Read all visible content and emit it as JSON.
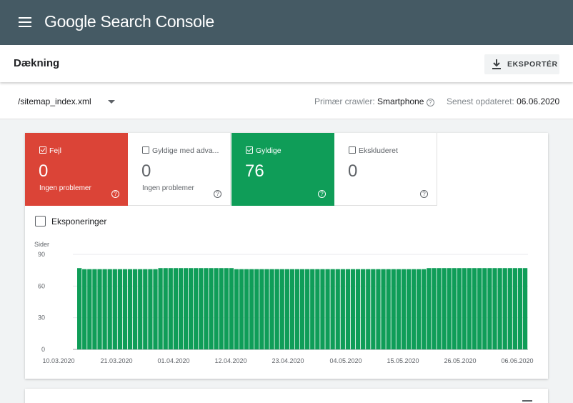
{
  "app": {
    "brand": "Google Search Console"
  },
  "page": {
    "title": "Dækning",
    "export_label": "EKSPORTÉR"
  },
  "filter": {
    "sitemap": "/sitemap_index.xml",
    "crawler_label": "Primær crawler:",
    "crawler_value": "Smartphone",
    "updated_label": "Senest opdateret:",
    "updated_value": "06.06.2020"
  },
  "tiles": [
    {
      "label": "Fejl",
      "value": "0",
      "sub": "Ingen problemer",
      "checked": true,
      "bg": "#db4437",
      "fg": "#ffffff"
    },
    {
      "label": "Gyldige med adva...",
      "value": "0",
      "sub": "Ingen problemer",
      "checked": false,
      "bg": "#ffffff",
      "fg": "#5f6368"
    },
    {
      "label": "Gyldige",
      "value": "76",
      "sub": "",
      "checked": true,
      "bg": "#0f9d58",
      "fg": "#ffffff"
    },
    {
      "label": "Ekskluderet",
      "value": "0",
      "sub": "",
      "checked": false,
      "bg": "#ffffff",
      "fg": "#5f6368"
    }
  ],
  "impressions": {
    "label": "Eksponeringer",
    "checked": false
  },
  "chart_data": {
    "type": "bar",
    "ylabel": "Sider",
    "ylim": [
      0,
      90
    ],
    "yticks": [
      0,
      30,
      60,
      90
    ],
    "xticks": [
      "10.03.2020",
      "21.03.2020",
      "01.04.2020",
      "12.04.2020",
      "23.04.2020",
      "04.05.2020",
      "15.05.2020",
      "26.05.2020",
      "06.06.2020"
    ],
    "series": [
      {
        "color": "#0f9d58",
        "values": [
          77,
          76,
          76,
          76,
          76,
          76,
          76,
          76,
          76,
          76,
          76,
          76,
          76,
          76,
          76,
          76,
          77,
          77,
          77,
          77,
          77,
          77,
          77,
          77,
          77,
          77,
          77,
          77,
          77,
          77,
          77,
          76,
          76,
          76,
          76,
          76,
          76,
          76,
          76,
          76,
          76,
          76,
          76,
          76,
          76,
          76,
          76,
          76,
          76,
          76,
          76,
          76,
          76,
          76,
          76,
          76,
          76,
          76,
          76,
          76,
          76,
          76,
          76,
          76,
          76,
          76,
          76,
          76,
          76,
          77,
          77,
          77,
          77,
          77,
          77,
          77,
          77,
          77,
          77,
          77,
          77,
          77,
          77,
          77,
          77,
          77,
          77,
          77,
          77
        ]
      }
    ],
    "grid": true
  },
  "colors": {
    "topbar": "#455a64",
    "accent_green": "#0f9d58",
    "error_red": "#db4437"
  }
}
